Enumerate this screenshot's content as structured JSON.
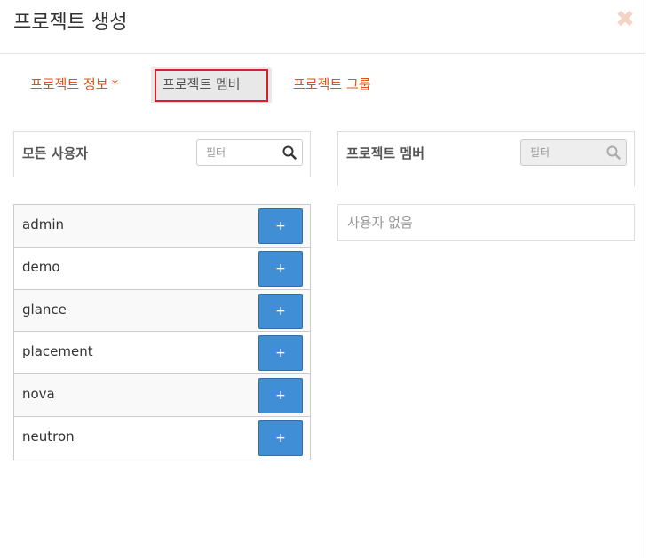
{
  "modal": {
    "title": "프로젝트 생성",
    "close_label": "✖"
  },
  "tabs": {
    "info_label": "프로젝트 정보",
    "info_required": "*",
    "members_label": "프로젝트 멤버",
    "groups_label": "프로젝트 그룹"
  },
  "all_users": {
    "title": "모든 사용자",
    "filter_placeholder": "필터",
    "add_label": "+",
    "users": [
      {
        "name": "admin"
      },
      {
        "name": "demo"
      },
      {
        "name": "glance"
      },
      {
        "name": "placement"
      },
      {
        "name": "nova"
      },
      {
        "name": "neutron"
      }
    ]
  },
  "project_members": {
    "title": "프로젝트 멤버",
    "filter_placeholder": "필터",
    "empty_text": "사용자 없음"
  },
  "colors": {
    "accent": "#e2511a",
    "button": "#3f8ed6",
    "highlight": "#d7202a"
  }
}
